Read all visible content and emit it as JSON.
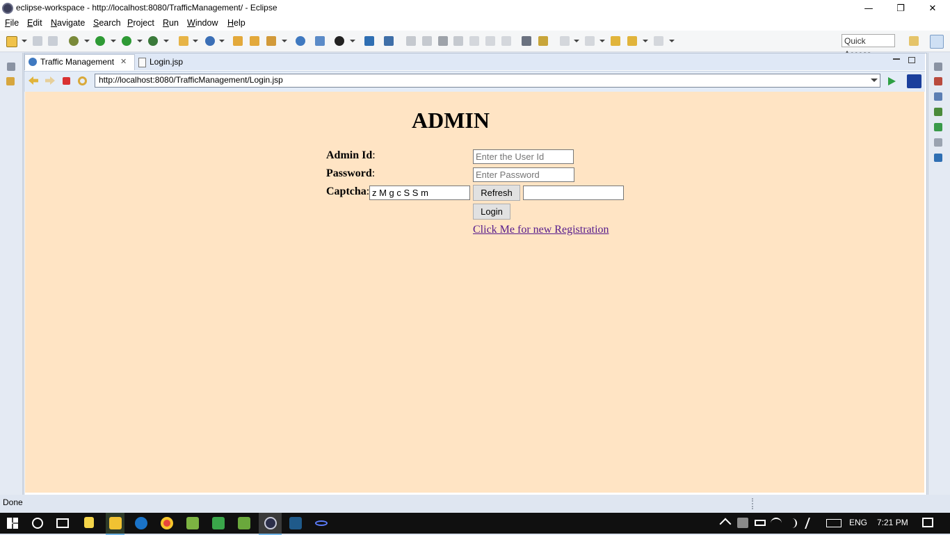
{
  "window": {
    "title": "eclipse-workspace - http://localhost:8080/TrafficManagement/ - Eclipse",
    "minimize_glyph": "—",
    "restore_glyph": "❐",
    "close_glyph": "✕"
  },
  "menu": {
    "items": [
      {
        "accel": "F",
        "rest": "ile"
      },
      {
        "accel": "E",
        "rest": "dit"
      },
      {
        "accel": "N",
        "rest": "avigate"
      },
      {
        "accel": "S",
        "rest": "earch"
      },
      {
        "accel": "P",
        "rest": "roject"
      },
      {
        "accel": "R",
        "rest": "un"
      },
      {
        "accel": "W",
        "rest": "indow"
      },
      {
        "accel": "H",
        "rest": "elp"
      }
    ]
  },
  "toolbar": {
    "quick_access_label": "Quick Access"
  },
  "tabs": [
    {
      "label": "Traffic Management",
      "close_glyph": "✕"
    },
    {
      "label": "Login.jsp"
    }
  ],
  "browser": {
    "url": "http://localhost:8080/TrafficManagement/Login.jsp"
  },
  "page": {
    "heading": "ADMIN",
    "admin_id_label": "Admin Id",
    "admin_id_placeholder": "Enter the User Id",
    "password_label": "Password",
    "password_placeholder": "Enter Password",
    "captcha_label": "Captcha",
    "captcha_value": "z M  g c S S m",
    "colon": ":",
    "refresh_button": "Refresh",
    "login_button": "Login",
    "register_link": "Click Me for new Registration"
  },
  "status": {
    "text": "Done"
  },
  "taskbar": {
    "language": "ENG",
    "time": "7:21 PM"
  },
  "colors": {
    "page_background": "#ffe4c4",
    "link": "#551a8b",
    "taskbar": "#101010"
  }
}
